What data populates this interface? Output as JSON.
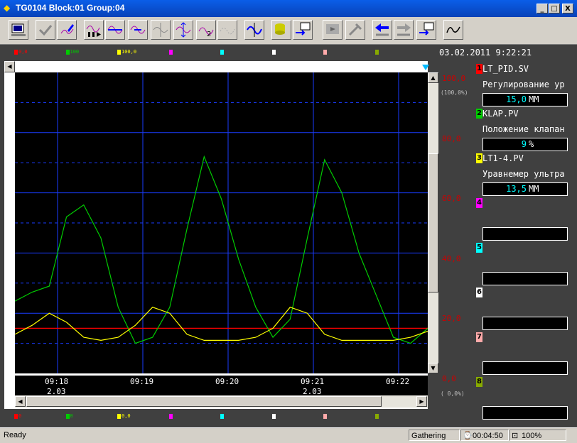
{
  "window": {
    "title": "TG0104 Block:01 Group:04",
    "min": "_",
    "max": "□",
    "close": "X"
  },
  "toolbar": {
    "buttons": [
      "monitor-icon",
      "check-icon",
      "pen-icon",
      "trend-play-icon",
      "trend-expand-icon",
      "trend-expand-icon",
      "trend-shrink-icon",
      "trend-vertical-expand-icon",
      "trend-alarm-icon",
      "trend-dotted-icon",
      "trend-cursor-icon",
      "database-icon",
      "export-icon",
      "record-icon",
      "tools-icon",
      "back-icon",
      "forward-icon",
      "export2-icon",
      "wave-icon"
    ]
  },
  "top_markers": [
    {
      "num": "1",
      "label": "0,0",
      "color": "#ff0000"
    },
    {
      "num": "2",
      "label": "100",
      "color": "#00cc00"
    },
    {
      "num": "3",
      "label": "100,0",
      "color": "#ffff00"
    },
    {
      "num": "4",
      "label": "",
      "color": "#ff00ff"
    },
    {
      "num": "5",
      "label": "",
      "color": "#00ffff"
    },
    {
      "num": "6",
      "label": "",
      "color": "#ffffff"
    },
    {
      "num": "7",
      "label": "",
      "color": "#ffaaaa"
    },
    {
      "num": "8",
      "label": "",
      "color": "#88aa00"
    }
  ],
  "bottom_markers": [
    {
      "num": "1",
      "label": "0",
      "color": "#ff0000"
    },
    {
      "num": "2",
      "label": "0",
      "color": "#00cc00"
    },
    {
      "num": "3",
      "label": "0,0",
      "color": "#ffff00"
    },
    {
      "num": "4",
      "label": "",
      "color": "#ff00ff"
    },
    {
      "num": "5",
      "label": "",
      "color": "#00ffff"
    },
    {
      "num": "6",
      "label": "",
      "color": "#ffffff"
    },
    {
      "num": "7",
      "label": "",
      "color": "#ffaaaa"
    },
    {
      "num": "8",
      "label": "",
      "color": "#88aa00"
    }
  ],
  "datetime": "03.02.2011 9:22:21",
  "y_axis": {
    "labels": [
      "100,0",
      "80,0",
      "60,0",
      "40,0",
      "20,0",
      "0,0"
    ],
    "top_sub": "(100,0%)",
    "bottom_sub": "( 0,0%)",
    "color": "#cc0000"
  },
  "time_axis": [
    {
      "time": "09:18",
      "date": "2.03"
    },
    {
      "time": "09:19",
      "date": ""
    },
    {
      "time": "09:20",
      "date": ""
    },
    {
      "time": "09:21",
      "date": "2.03"
    },
    {
      "time": "09:22",
      "date": ""
    }
  ],
  "channels": [
    {
      "num": "1",
      "tag": "LT_PID.SV",
      "desc": "Регулирование ур",
      "value": "15,0",
      "unit": "ММ",
      "color": "#ff0000",
      "value_color": "#00ffff"
    },
    {
      "num": "2",
      "tag": "KLAP.PV",
      "desc": "Положение клапан",
      "value": "9",
      "unit": "%",
      "color": "#00cc00",
      "value_color": "#00ffff"
    },
    {
      "num": "3",
      "tag": "LT1-4.PV",
      "desc": "Уравнемер ультра",
      "value": "13,5",
      "unit": "ММ",
      "color": "#ffff00",
      "value_color": "#00ffff"
    },
    {
      "num": "4",
      "tag": "",
      "desc": "",
      "value": "",
      "unit": "",
      "color": "#ff00ff",
      "value_color": "#00ffff"
    },
    {
      "num": "5",
      "tag": "",
      "desc": "",
      "value": "",
      "unit": "",
      "color": "#00ffff",
      "value_color": "#00ffff"
    },
    {
      "num": "6",
      "tag": "",
      "desc": "",
      "value": "",
      "unit": "",
      "color": "#ffffff",
      "value_color": "#00ffff"
    },
    {
      "num": "7",
      "tag": "",
      "desc": "",
      "value": "",
      "unit": "",
      "color": "#ffaaaa",
      "value_color": "#00ffff"
    },
    {
      "num": "8",
      "tag": "",
      "desc": "",
      "value": "",
      "unit": "",
      "color": "#88aa00",
      "value_color": "#00ffff"
    }
  ],
  "status": {
    "ready": "Ready",
    "gathering": "Gathering",
    "elapsed": "00:04:50",
    "zoom": "100%"
  },
  "chart_data": {
    "type": "line",
    "ylim": [
      0,
      100
    ],
    "x_ticks": [
      "09:18",
      "09:19",
      "09:20",
      "09:21",
      "09:22"
    ],
    "series": [
      {
        "name": "LT_PID.SV",
        "color": "#ff0000",
        "values": [
          15,
          15,
          15,
          15,
          15,
          15,
          15,
          15,
          15,
          15,
          15,
          15,
          15,
          15,
          15,
          15,
          15,
          15,
          15,
          15,
          15,
          15,
          15,
          15,
          15
        ]
      },
      {
        "name": "KLAP.PV",
        "color": "#00cc00",
        "values": [
          24,
          27,
          29,
          52,
          56,
          45,
          22,
          10,
          12,
          22,
          48,
          72,
          58,
          38,
          22,
          12,
          18,
          45,
          71,
          60,
          40,
          26,
          12,
          10,
          15
        ]
      },
      {
        "name": "LT1-4.PV",
        "color": "#ffff00",
        "values": [
          13,
          16,
          20,
          17,
          12,
          11,
          12,
          16,
          22,
          20,
          13,
          11,
          11,
          11,
          12,
          15,
          22,
          20,
          13,
          11,
          11,
          11,
          11,
          12,
          14
        ]
      }
    ]
  }
}
